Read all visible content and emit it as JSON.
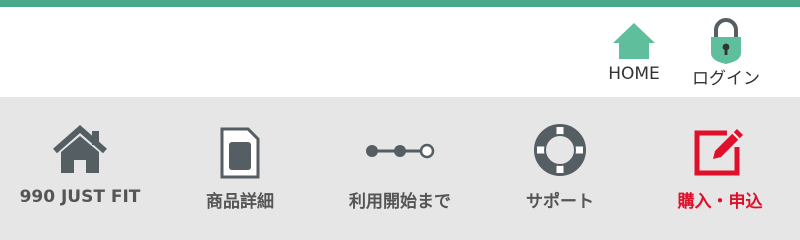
{
  "colors": {
    "brand_green": "#4aa98a",
    "icon_green": "#5fbf9c",
    "nav_background": "#e6e6e6",
    "nav_text": "#555555",
    "nav_icon": "#555e63",
    "highlight_red": "#e0102b"
  },
  "header": {
    "home": {
      "label": "HOME",
      "icon": "home-icon"
    },
    "login": {
      "label": "ログイン",
      "icon": "lock-icon"
    }
  },
  "nav": {
    "items": [
      {
        "label": "990 JUST FIT",
        "icon": "house-icon"
      },
      {
        "label": "商品詳細",
        "icon": "sim-card-icon"
      },
      {
        "label": "利用開始まで",
        "icon": "steps-icon"
      },
      {
        "label": "サポート",
        "icon": "lifebuoy-icon"
      },
      {
        "label": "購入・申込",
        "icon": "edit-icon",
        "highlight": true
      }
    ]
  }
}
